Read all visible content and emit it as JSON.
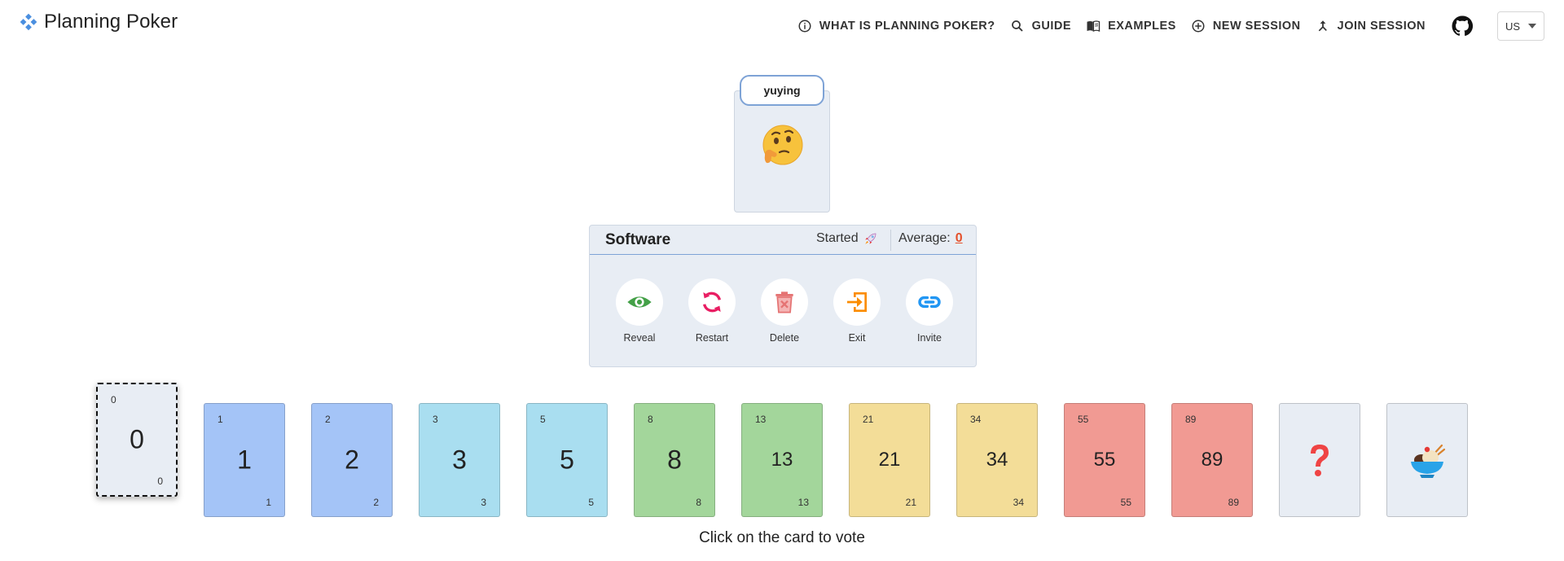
{
  "header": {
    "app_title": "Planning Poker",
    "nav": [
      {
        "label": "WHAT IS PLANNING POKER?",
        "icon": "info-icon"
      },
      {
        "label": "GUIDE",
        "icon": "search-icon"
      },
      {
        "label": "EXAMPLES",
        "icon": "book-icon"
      },
      {
        "label": "NEW SESSION",
        "icon": "plus-circle-icon"
      },
      {
        "label": "JOIN SESSION",
        "icon": "merge-icon"
      }
    ],
    "language": "US"
  },
  "player": {
    "name": "yuying",
    "status_icon": "thinking-face-icon"
  },
  "session": {
    "title": "Software",
    "status": "Started",
    "status_icon": "rocket-icon",
    "average_label": "Average:",
    "average_value": "0",
    "actions": [
      {
        "label": "Reveal",
        "icon": "eye-icon",
        "color": "#43a047"
      },
      {
        "label": "Restart",
        "icon": "restart-icon",
        "color": "#e91e63"
      },
      {
        "label": "Delete",
        "icon": "trash-icon",
        "color": "#e57373"
      },
      {
        "label": "Exit",
        "icon": "exit-icon",
        "color": "#fb8c00"
      },
      {
        "label": "Invite",
        "icon": "link-icon",
        "color": "#2196f3"
      }
    ]
  },
  "cards": [
    {
      "value": "0",
      "color": "#e8edf4",
      "selected": true
    },
    {
      "value": "1",
      "color": "#a4c4f7"
    },
    {
      "value": "2",
      "color": "#a4c4f7"
    },
    {
      "value": "3",
      "color": "#a9def0"
    },
    {
      "value": "5",
      "color": "#a9def0"
    },
    {
      "value": "8",
      "color": "#a3d69b"
    },
    {
      "value": "13",
      "color": "#a3d69b"
    },
    {
      "value": "21",
      "color": "#f3dd98"
    },
    {
      "value": "34",
      "color": "#f3dd98"
    },
    {
      "value": "55",
      "color": "#f19a93"
    },
    {
      "value": "89",
      "color": "#f19a93"
    },
    {
      "value": "",
      "color": "#e8edf4",
      "icon": "question-icon"
    },
    {
      "value": "",
      "color": "#e8edf4",
      "icon": "coffee-break-icon"
    }
  ],
  "hint": "Click on the card to vote"
}
